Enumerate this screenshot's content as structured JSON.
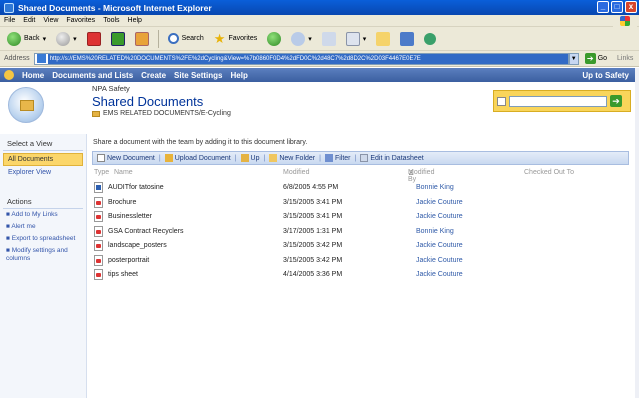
{
  "window": {
    "title": "Shared Documents - Microsoft Internet Explorer",
    "buttons": [
      "_",
      "□",
      "x"
    ]
  },
  "menu": [
    "File",
    "Edit",
    "View",
    "Favorites",
    "Tools",
    "Help"
  ],
  "toolbar": {
    "back": "Back",
    "search": "Search",
    "favorites": "Favorites"
  },
  "address": {
    "label": "Address",
    "url": "http://s://EMS%20RELATED%20DOCUMENTS%2FE%2dCycling&View=%7b0860F0D4%2dFD0C%2d48C7%2d8D2C%2D03F4467E0E7E",
    "go": "Go",
    "links": "Links"
  },
  "sp_nav": {
    "items": [
      "Home",
      "Documents and Lists",
      "Create",
      "Site Settings",
      "Help"
    ],
    "up": "Up to Safety"
  },
  "header": {
    "site": "NPA Safety",
    "title": "Shared Documents",
    "crumb": "EMS RELATED DOCUMENTS/E-Cycling"
  },
  "leftnav": {
    "select_view": "Select a View",
    "views": [
      "All Documents",
      "Explorer View"
    ],
    "actions_heading": "Actions",
    "actions": [
      "Add to My Links",
      "Alert me",
      "Export to spreadsheet",
      "Modify settings and columns"
    ]
  },
  "main": {
    "description": "Share a document with the team by adding it to this document library.",
    "list_toolbar": [
      "New Document",
      "Upload Document",
      "Up",
      "New Folder",
      "Filter",
      "Edit in Datasheet"
    ],
    "columns": [
      "Type",
      "Name",
      "Modified",
      "Modified By",
      "Checked Out To"
    ],
    "rows": [
      {
        "icon": "doc",
        "name": "AUDITfor tatosine",
        "modified": "6/8/2005 4:55 PM",
        "by": "Bonnie King"
      },
      {
        "icon": "pdf",
        "name": "Brochure",
        "modified": "3/15/2005 3:41 PM",
        "by": "Jackie Couture"
      },
      {
        "icon": "pdf",
        "name": "Businessletter",
        "modified": "3/15/2005 3:41 PM",
        "by": "Jackie Couture"
      },
      {
        "icon": "pdf",
        "name": "GSA Contract Recyclers",
        "modified": "3/17/2005 1:31 PM",
        "by": "Bonnie King"
      },
      {
        "icon": "pdf",
        "name": "landscape_posters",
        "modified": "3/15/2005 3:42 PM",
        "by": "Jackie Couture"
      },
      {
        "icon": "pdf",
        "name": "posterportrait",
        "modified": "3/15/2005 3:42 PM",
        "by": "Jackie Couture"
      },
      {
        "icon": "pdf",
        "name": "tips sheet",
        "modified": "4/14/2005 3:36 PM",
        "by": "Jackie Couture"
      }
    ]
  },
  "colors": {
    "titlebar": "#0a5fd9",
    "sp_nav": "#3b5fa0",
    "highlight": "#fbd66a",
    "link": "#2f5aa8"
  }
}
